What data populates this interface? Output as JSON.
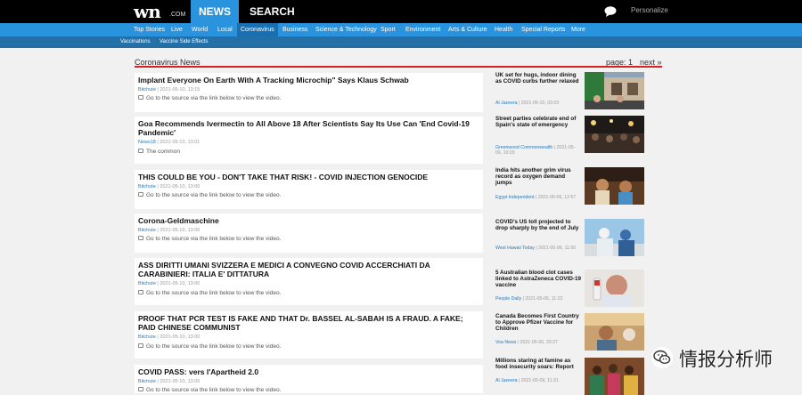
{
  "header": {
    "logo_main": "wn",
    "logo_suffix": ".COM",
    "tab_news": "NEWS",
    "tab_search": "SEARCH",
    "personalize": "Personalize"
  },
  "nav": {
    "primary": [
      "Top Stories",
      "Live",
      "World",
      "Local",
      "Coronavirus",
      "Business",
      "Science & Technology",
      "Sport",
      "Environment",
      "Arts & Culture",
      "Health",
      "Special Reports",
      "More"
    ],
    "active": "Coronavirus",
    "secondary": [
      "Vaccinations",
      "Vaccine Side Effects"
    ]
  },
  "section": {
    "title": "Coronavirus News",
    "page_label": "page: 1",
    "next_label": "next »"
  },
  "articles": [
    {
      "title": "Implant Everyone On Earth With A Tracking Microchip\" Says Klaus Schwab",
      "source": "Bitchute",
      "date": "2021-05-10, 13:15",
      "desc": "Go to the source via the link below to view the video."
    },
    {
      "title": "Goa Recommends Ivermectin to All Above 18 After Scientists Say Its Use Can 'End Covid-19 Pandemic'",
      "source": "News18",
      "date": "2021-05-10, 13:01",
      "desc": "The common"
    },
    {
      "title": "THIS COULD BE YOU - DON'T TAKE THAT RISK! - COVID INJECTION GENOCIDE",
      "source": "Bitchute",
      "date": "2021-05-10, 13:00",
      "desc": "Go to the source via the link below to view the video."
    },
    {
      "title": "Corona-Geldmaschine",
      "source": "Bitchute",
      "date": "2021-05-10, 13:00",
      "desc": "Go to the source via the link below to view the video."
    },
    {
      "title": "ASS DIRITTI UMANI SVIZZERA E MEDICI A CONVEGNO COVID ACCERCHIATI DA CARABINIERI: ITALIA E' DITTATURA",
      "source": "Bitchute",
      "date": "2021-05-10, 13:00",
      "desc": "Go to the source via the link below to view the video."
    },
    {
      "title": "PROOF THAT PCR TEST IS FAKE AND THAT Dr. BASSEL AL-SABAH IS A FRAUD. A FAKE; PAID CHINESE COMMUNIST",
      "source": "Bitchute",
      "date": "2021-05-10, 13:00",
      "desc": "Go to the source via the link below to view the video."
    },
    {
      "title": "COVID PASS: vers l'Apartheid 2.0",
      "source": "Bitchute",
      "date": "2021-05-10, 13:00",
      "desc": "Go to the source via the link below to view the video."
    }
  ],
  "sidebar": [
    {
      "title": "UK set for hugs, indoor dining as COVID curbs further relaxed",
      "source": "Al Jazeera",
      "date": "2021-05-10, 03:03"
    },
    {
      "title": "Street parties celebrate end of Spain's state of emergency",
      "source": "Greenwood Commonwealth",
      "date": "2021-05-09, 10:29"
    },
    {
      "title": "India hits another grim virus record as oxygen demand jumps",
      "source": "Egypt Independent",
      "date": "2021-05-06, 12:57"
    },
    {
      "title": "COVID's US toll projected to drop sharply by the end of July",
      "source": "West Hawaii Today",
      "date": "2021-05-06, 11:50"
    },
    {
      "title": "5 Australian blood clot cases linked to AstraZeneca COVID-19 vaccine",
      "source": "People Daily",
      "date": "2021-05-06, 11:23"
    },
    {
      "title": "Canada Becomes First Country to Approve Pfizer Vaccine for Children",
      "source": "Voa News",
      "date": "2021-05-05, 20:27"
    },
    {
      "title": "Millions staring at famine as food insecurity soars: Report",
      "source": "Al Jazeera",
      "date": "2021-05-09, 11:31"
    }
  ],
  "watermark": {
    "text": "情报分析师"
  },
  "colors": {
    "topbar": "#000000",
    "accent_blue": "#2a93de",
    "subnav_blue": "#236fa8",
    "rule_red": "#d9202a",
    "link_blue": "#2a7ab8"
  }
}
